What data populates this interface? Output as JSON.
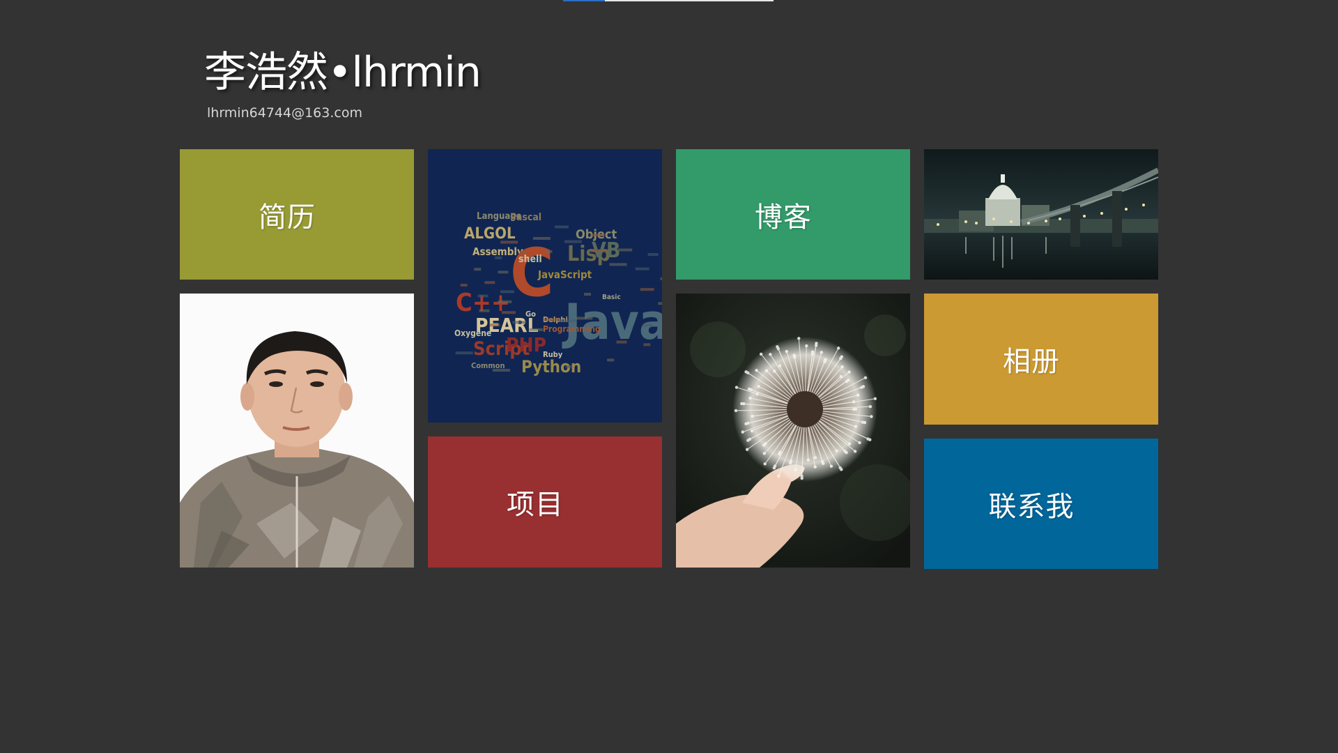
{
  "progress": {
    "value": 0.2
  },
  "header": {
    "title": "李浩然•lhrmin",
    "email": "lhrmin64744@163.com"
  },
  "tiles": {
    "resume": {
      "label": "简历",
      "color": "#989a34"
    },
    "blog": {
      "label": "博客",
      "color": "#339a6a"
    },
    "project": {
      "label": "项目",
      "color": "#982f30"
    },
    "album": {
      "label": "相册",
      "color": "#cc9a33"
    },
    "contact": {
      "label": "联系我",
      "color": "#01669a"
    }
  },
  "word_cloud": {
    "words": [
      "Language",
      "Pascal",
      "ALGOL",
      "Assembly",
      "C",
      "C++",
      "shell",
      "JavaScript",
      "Lisp",
      "VB",
      "Object",
      "PEARL",
      "Script",
      "PHP",
      "Java",
      "Python",
      "Ruby",
      "Programming",
      "Delphi",
      "Oxygene",
      "Common",
      "Go",
      "Basic"
    ]
  },
  "icons": {
    "portrait": "portrait-photo",
    "word_cloud": "programming-languages-word-cloud",
    "dandelion": "dandelion-photo",
    "city": "night-city-skyline-photo"
  }
}
